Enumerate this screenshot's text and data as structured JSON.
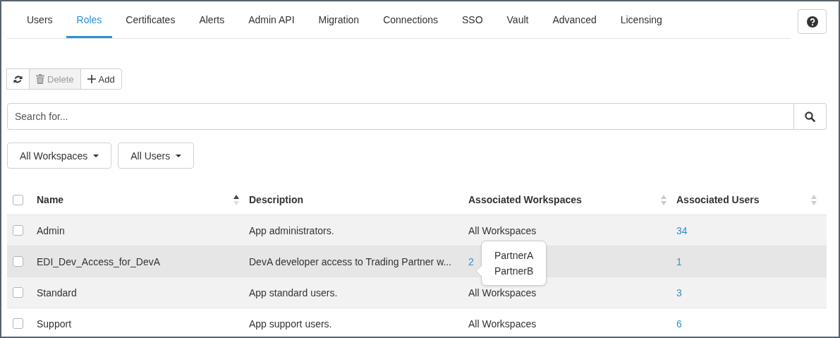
{
  "tabs": [
    {
      "label": "Users",
      "selected": false
    },
    {
      "label": "Roles",
      "selected": true
    },
    {
      "label": "Certificates",
      "selected": false
    },
    {
      "label": "Alerts",
      "selected": false
    },
    {
      "label": "Admin API",
      "selected": false
    },
    {
      "label": "Migration",
      "selected": false
    },
    {
      "label": "Connections",
      "selected": false
    },
    {
      "label": "SSO",
      "selected": false
    },
    {
      "label": "Vault",
      "selected": false
    },
    {
      "label": "Advanced",
      "selected": false
    },
    {
      "label": "Licensing",
      "selected": false
    }
  ],
  "toolbar": {
    "buttons": [
      {
        "kind": "refresh",
        "disabled": false
      },
      {
        "kind": "delete",
        "label": "Delete",
        "disabled": true
      },
      {
        "kind": "add",
        "label": "Add",
        "disabled": false
      }
    ]
  },
  "search": {
    "placeholder": "Search for..."
  },
  "filters": [
    {
      "label": "All Workspaces"
    },
    {
      "label": "All Users"
    }
  ],
  "table": {
    "select_all_checked": false,
    "columns": [
      {
        "label": "Name",
        "sortable": true,
        "sorted": true
      },
      {
        "label": "Description",
        "sortable": false,
        "sorted": false
      },
      {
        "label": "Associated Workspaces",
        "sortable": true,
        "sorted": false
      },
      {
        "label": "Associated Users",
        "sortable": true,
        "sorted": false
      }
    ],
    "rows": [
      {
        "checked": false,
        "hovered": false,
        "name": "Admin",
        "description": "App administrators.",
        "workspaces": {
          "text": "All Workspaces",
          "kind": "text"
        },
        "users": "34"
      },
      {
        "checked": false,
        "hovered": true,
        "name": "EDI_Dev_Access_for_DevA",
        "description": "DevA developer access to Trading Partner w...",
        "workspaces": {
          "text": "2",
          "kind": "link",
          "popover": [
            "PartnerA",
            "PartnerB"
          ]
        },
        "users": "1"
      },
      {
        "checked": false,
        "hovered": false,
        "name": "Standard",
        "description": "App standard users.",
        "workspaces": {
          "text": "All Workspaces",
          "kind": "text"
        },
        "users": "3"
      },
      {
        "checked": false,
        "hovered": false,
        "name": "Support",
        "description": "App support users.",
        "workspaces": {
          "text": "All Workspaces",
          "kind": "text"
        },
        "users": "6"
      }
    ]
  }
}
